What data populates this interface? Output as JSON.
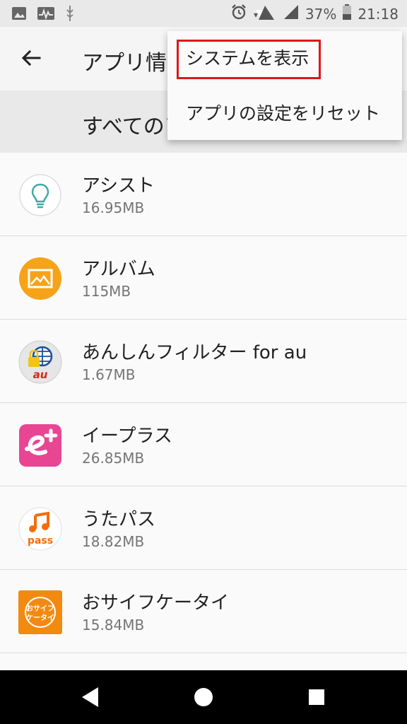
{
  "status_bar": {
    "battery": "37%",
    "time": "21:18",
    "icons": [
      "image-icon",
      "activity-icon",
      "usb-icon",
      "alarm-icon",
      "wifi-icon",
      "signal-icon",
      "battery-icon"
    ]
  },
  "app_bar": {
    "title": "アプリ情報"
  },
  "filter": {
    "label": "すべてのアプリ"
  },
  "menu": {
    "items": [
      "システムを表示",
      "アプリの設定をリセット"
    ]
  },
  "apps": [
    {
      "name": "アシスト",
      "size": "16.95MB",
      "icon": "lightbulb-icon"
    },
    {
      "name": "アルバム",
      "size": "115MB",
      "icon": "album-icon"
    },
    {
      "name": "あんしんフィルター for au",
      "size": "1.67MB",
      "icon": "safety-filter-icon"
    },
    {
      "name": "イープラス",
      "size": "26.85MB",
      "icon": "eplus-icon"
    },
    {
      "name": "うたパス",
      "size": "18.82MB",
      "icon": "utapass-icon"
    },
    {
      "name": "おサイフケータイ",
      "size": "15.84MB",
      "icon": "osaifu-icon"
    }
  ],
  "icon_labels": {
    "au": "au",
    "pass": "pass",
    "osaifu_line1": "おサイフ",
    "osaifu_line2": "ケータイ"
  },
  "colors": {
    "highlight": "#e0151c",
    "album_orange": "#f6a31a",
    "eplus_pink": "#e84593",
    "utapass_orange": "#f26d0a",
    "osaifu_orange": "#f28a10"
  }
}
